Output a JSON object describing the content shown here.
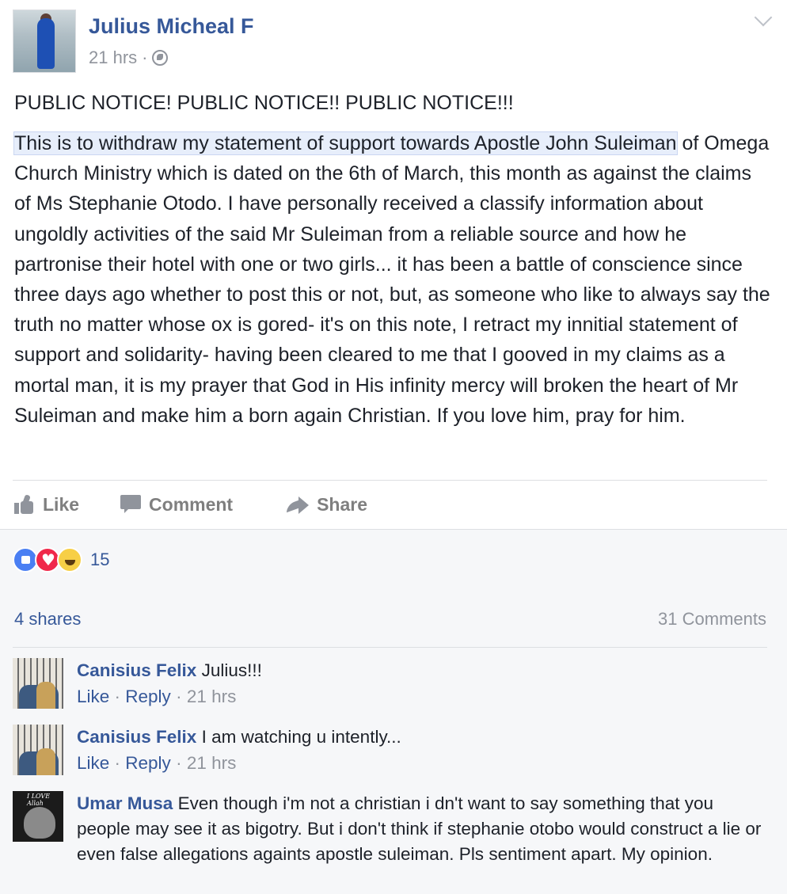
{
  "post": {
    "author": "Julius Micheal F",
    "time": "21 hrs",
    "dot": "·",
    "title": "PUBLIC NOTICE! PUBLIC NOTICE!! PUBLIC NOTICE!!!",
    "highlighted": "This is to withdraw my statement of support towards Apostle John Suleiman",
    "body_rest": " of Omega Church Ministry which is dated on the 6th of March, this month as against the claims of Ms Stephanie Otodo. I have personally received a classify information about ungoldly activities of the said Mr Suleiman from a reliable source and how he partronise their hotel with one or two girls... it has been a battle of conscience since three days ago whether to post this or not, but, as someone who like to always say the truth no matter whose ox is gored- it's on this note, I retract my innitial statement of support and solidarity- having been cleared to me that I gooved in my claims as a mortal man, it is my prayer that God in His infinity mercy will broken the heart of Mr Suleiman and make him a born again Christian. If you love him, pray for him."
  },
  "actions": {
    "like": "Like",
    "comment": "Comment",
    "share": "Share"
  },
  "stats": {
    "reactions": "15",
    "shares": "4 shares",
    "comments": "31 Comments"
  },
  "comments": [
    {
      "name": "Canisius Felix",
      "text": "Julius!!!",
      "like": "Like",
      "reply": "Reply",
      "time": "21 hrs"
    },
    {
      "name": "Canisius Felix",
      "text": "I am watching u intently...",
      "like": "Like",
      "reply": "Reply",
      "time": "21 hrs"
    },
    {
      "name": "Umar Musa",
      "text": "Even though i'm not a christian i dn't want to say something that you people may see it as bigotry. But i don't think if stephanie otobo would construct a lie or even false allegations againts apostle suleiman. Pls sentiment apart. My opinion.",
      "avatar_caption": "I LOVE Allah"
    }
  ],
  "colors": {
    "link": "#365899",
    "muted": "#90949c",
    "text": "#1d2129"
  },
  "icons": [
    "globe-icon",
    "chevron-down-icon",
    "like-icon",
    "comment-icon",
    "share-icon"
  ]
}
